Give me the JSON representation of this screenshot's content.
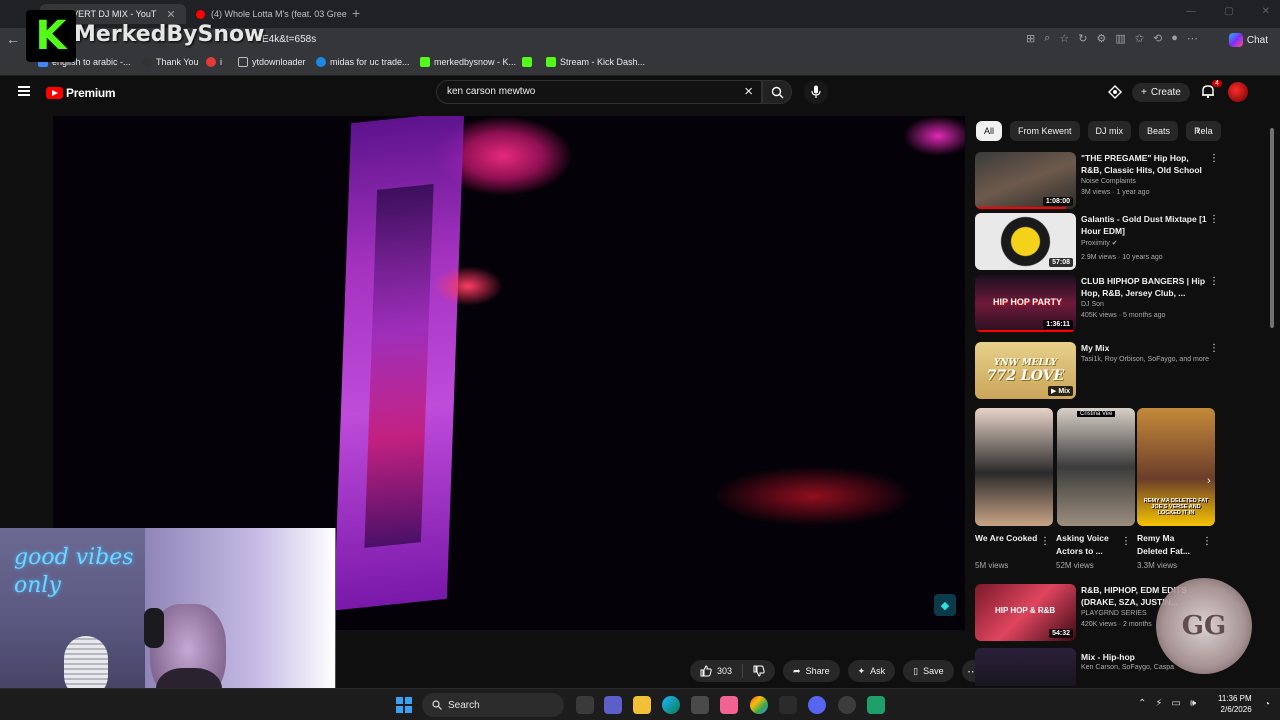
{
  "browser": {
    "tabs": [
      {
        "title": "L UZI VERT DJ MIX - YouT",
        "active": true
      },
      {
        "title": "(4) Whole Lotta M's (feat. 03 Gree",
        "active": false
      }
    ],
    "url": "E4k&t=658s",
    "chat_label": "Chat",
    "bookmarks": [
      {
        "label": "english to arabic -..."
      },
      {
        "label": "Thank You"
      },
      {
        "label": "i"
      },
      {
        "label": "ytdownloader"
      },
      {
        "label": "midas for uc trade..."
      },
      {
        "label": "merkedbysnow - K..."
      },
      {
        "label": ""
      },
      {
        "label": "Stream - Kick Dash..."
      }
    ]
  },
  "overlay": {
    "kick_letter": "K",
    "streamer_name": "MerkedBySnow",
    "webcam_sign": "good vibes only",
    "gg_badge": "GG"
  },
  "youtube": {
    "logo_text": "Premium",
    "search": {
      "query": "ken carson mewtwo"
    },
    "create_label": "Create",
    "notifications_count": "4"
  },
  "actions": {
    "likes": "303",
    "share": "Share",
    "ask": "Ask",
    "save": "Save"
  },
  "sidebar": {
    "chips": [
      "All",
      "From Kewent",
      "DJ mix",
      "Beats",
      "Rela"
    ],
    "recommendations": [
      {
        "title": "\"THE PREGAME\" Hip Hop, R&B, Classic Hits, Old School + | DJ...",
        "channel": "Noise Complaints",
        "meta": "3M views · 1 year ago",
        "duration": "1:08:00",
        "progress": 0.9
      },
      {
        "title": "Galantis - Gold Dust Mixtape [1 Hour EDM]",
        "channel": "Proximity",
        "meta": "2.9M views · 10 years ago",
        "duration": "57:08",
        "progress": 0
      },
      {
        "title": "CLUB HIPHOP BANGERS | Hip Hop, R&B, Jersey Club, ...",
        "channel": "DJ Son",
        "meta": "405K views · 5 months ago",
        "duration": "1:36:11",
        "progress": 1.0
      },
      {
        "title": "My Mix",
        "channel": "Tasi1k, Roy Orbison, SoFaygo, and more",
        "meta": "",
        "duration": "Mix",
        "progress": 0
      }
    ],
    "shorts": [
      {
        "title": "We Are Cooked",
        "views": "5M views"
      },
      {
        "title": "Asking Voice Actors to ...",
        "views": "52M views"
      },
      {
        "title": "Remy Ma Deleted Fat...",
        "views": "3.3M views"
      }
    ],
    "more_recs": [
      {
        "title": "R&B, HIPHOP, EDM EDITS (DRAKE, SZA, JUSTIN...",
        "channel": "PLAYGRND SERIES",
        "meta": "420K views · 2 months",
        "duration": "54:32"
      },
      {
        "title": "Mix - Hip-hop",
        "channel": "Ken Carson, SoFaygo, Caspa",
        "meta": "",
        "duration": ""
      }
    ],
    "thumb_texts": {
      "hiphop_party": "HIP HOP PARTY",
      "ynw_line1": "YNW MELLY",
      "ynw_line2": "772 LOVE",
      "shorts_badge": "Cristina Vee",
      "remy_caption": "REMY MA DELETED FAT JOE'S VERSE AND LOCKED IT IN",
      "hiphop_rnb": "HIP HOP & R&B"
    }
  },
  "taskbar": {
    "search_label": "Search",
    "time": "11:36 PM",
    "date": "2/6/2026"
  }
}
